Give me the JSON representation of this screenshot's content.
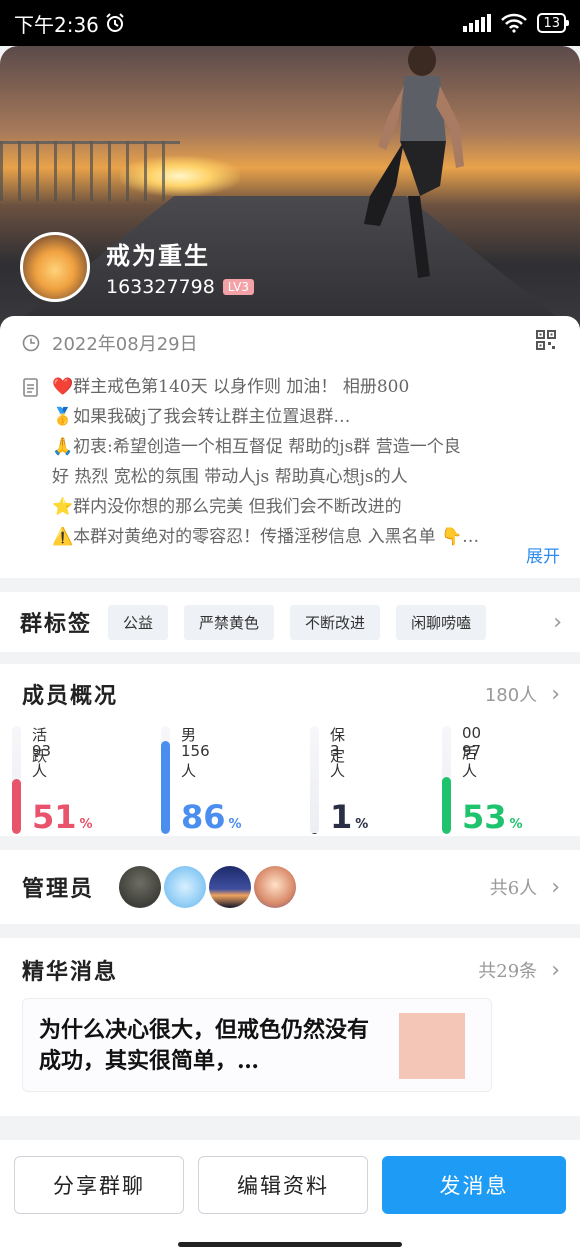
{
  "status_bar": {
    "time": "下午2:36",
    "battery": "13"
  },
  "group": {
    "name": "戒为重生",
    "id": "163327798",
    "level": "LV3"
  },
  "info": {
    "date": "2022年08月29日",
    "description_lines": [
      "❤️群主戒色第140天 以身作则 加油！ 相册800",
      "🥇如果我破j了我会转让群主位置退群…",
      "🙏初衷:希望创造一个相互督促 帮助的js群 营造一个良",
      "好 热烈 宽松的氛围 带动人js 帮助真心想js的人",
      "⭐群内没你想的那么完美 但我们会不断改进的",
      "⚠️本群对黄绝对的零容忍！传播淫秽信息 入黑名单 👇…"
    ],
    "expand_label": "展开"
  },
  "tags": {
    "title": "群标签",
    "items": [
      "公益",
      "严禁黄色",
      "不断改进",
      "闲聊唠嗑"
    ]
  },
  "members": {
    "title": "成员概况",
    "count": "180人",
    "stats": [
      {
        "label": "活跃",
        "count": "93人",
        "percent": 51,
        "color": "#e8546b"
      },
      {
        "label": "男",
        "count": "156人",
        "percent": 86,
        "color": "#4a8ef0"
      },
      {
        "label": "保定",
        "count": "3人",
        "percent": 1,
        "color": "#2a2f45"
      },
      {
        "label": "00后",
        "count": "97人",
        "percent": 53,
        "color": "#1fc36e"
      }
    ],
    "percent_unit": "%"
  },
  "admins": {
    "title": "管理员",
    "count": "共6人"
  },
  "essence": {
    "title": "精华消息",
    "count": "共29条",
    "card_text": "为什么决心很大，但戒色仍然没有成功，其实很简单，…"
  },
  "actions": {
    "share": "分享群聊",
    "edit": "编辑资料",
    "send": "发消息"
  }
}
